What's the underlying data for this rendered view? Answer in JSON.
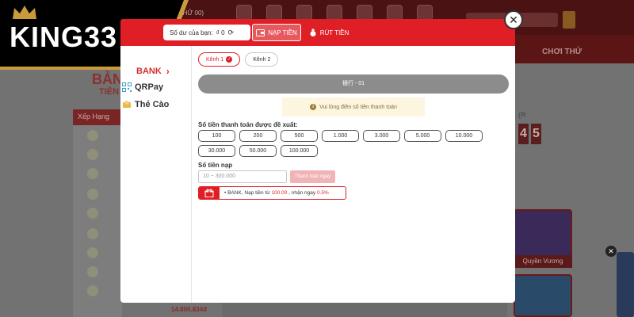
{
  "brand": {
    "logo_text": "KING33"
  },
  "background": {
    "header_balance": "(HỮ 00)",
    "nav_right": "CHƠI THỬ",
    "title": "BẢN",
    "title_sub": "TIỀN",
    "rank_header": "Xếp Hạng",
    "amount": "14.800.834đ",
    "jackpot_label": "(R",
    "jackpot_digits": [
      "4",
      "5"
    ],
    "game_label": "Quyền Vương"
  },
  "modal": {
    "balance_label": "Số dư của bạn:",
    "balance_value": "₫ 0",
    "tabs": [
      {
        "label": "NẠP TIỀN",
        "active": true
      },
      {
        "label": "RÚT TIỀN",
        "active": false
      }
    ],
    "sidebar": [
      {
        "label": "BANK"
      },
      {
        "label": "QRPay"
      },
      {
        "label": "Thẻ Cào"
      }
    ],
    "channels": [
      {
        "label": "Kênh 1",
        "active": true
      },
      {
        "label": "Kênh 2",
        "active": false
      }
    ],
    "bank_bar": "银行 - 01",
    "notice": "Vui lòng điền số tiền thanh toán",
    "suggest_label": "Số tiền thanh toán được đề xuất:",
    "amounts": [
      "100",
      "200",
      "500",
      "1.000",
      "3.000",
      "5.000",
      "10.000",
      "30.000",
      "50.000",
      "100.000"
    ],
    "deposit_label": "Số tiền nạp",
    "deposit_placeholder": "10 ~ 300.000",
    "pay_button": "Thanh toán ngay",
    "promo": {
      "bullet": "•",
      "bank": "BANK,",
      "text1": "Nạp tiền từ",
      "min": "100.00",
      "sep": ",",
      "text2": "nhận ngay",
      "rate": "0.5%"
    }
  },
  "close_label": "✕",
  "colors": {
    "primary": "#e01e25",
    "gold": "#c89b3c"
  }
}
